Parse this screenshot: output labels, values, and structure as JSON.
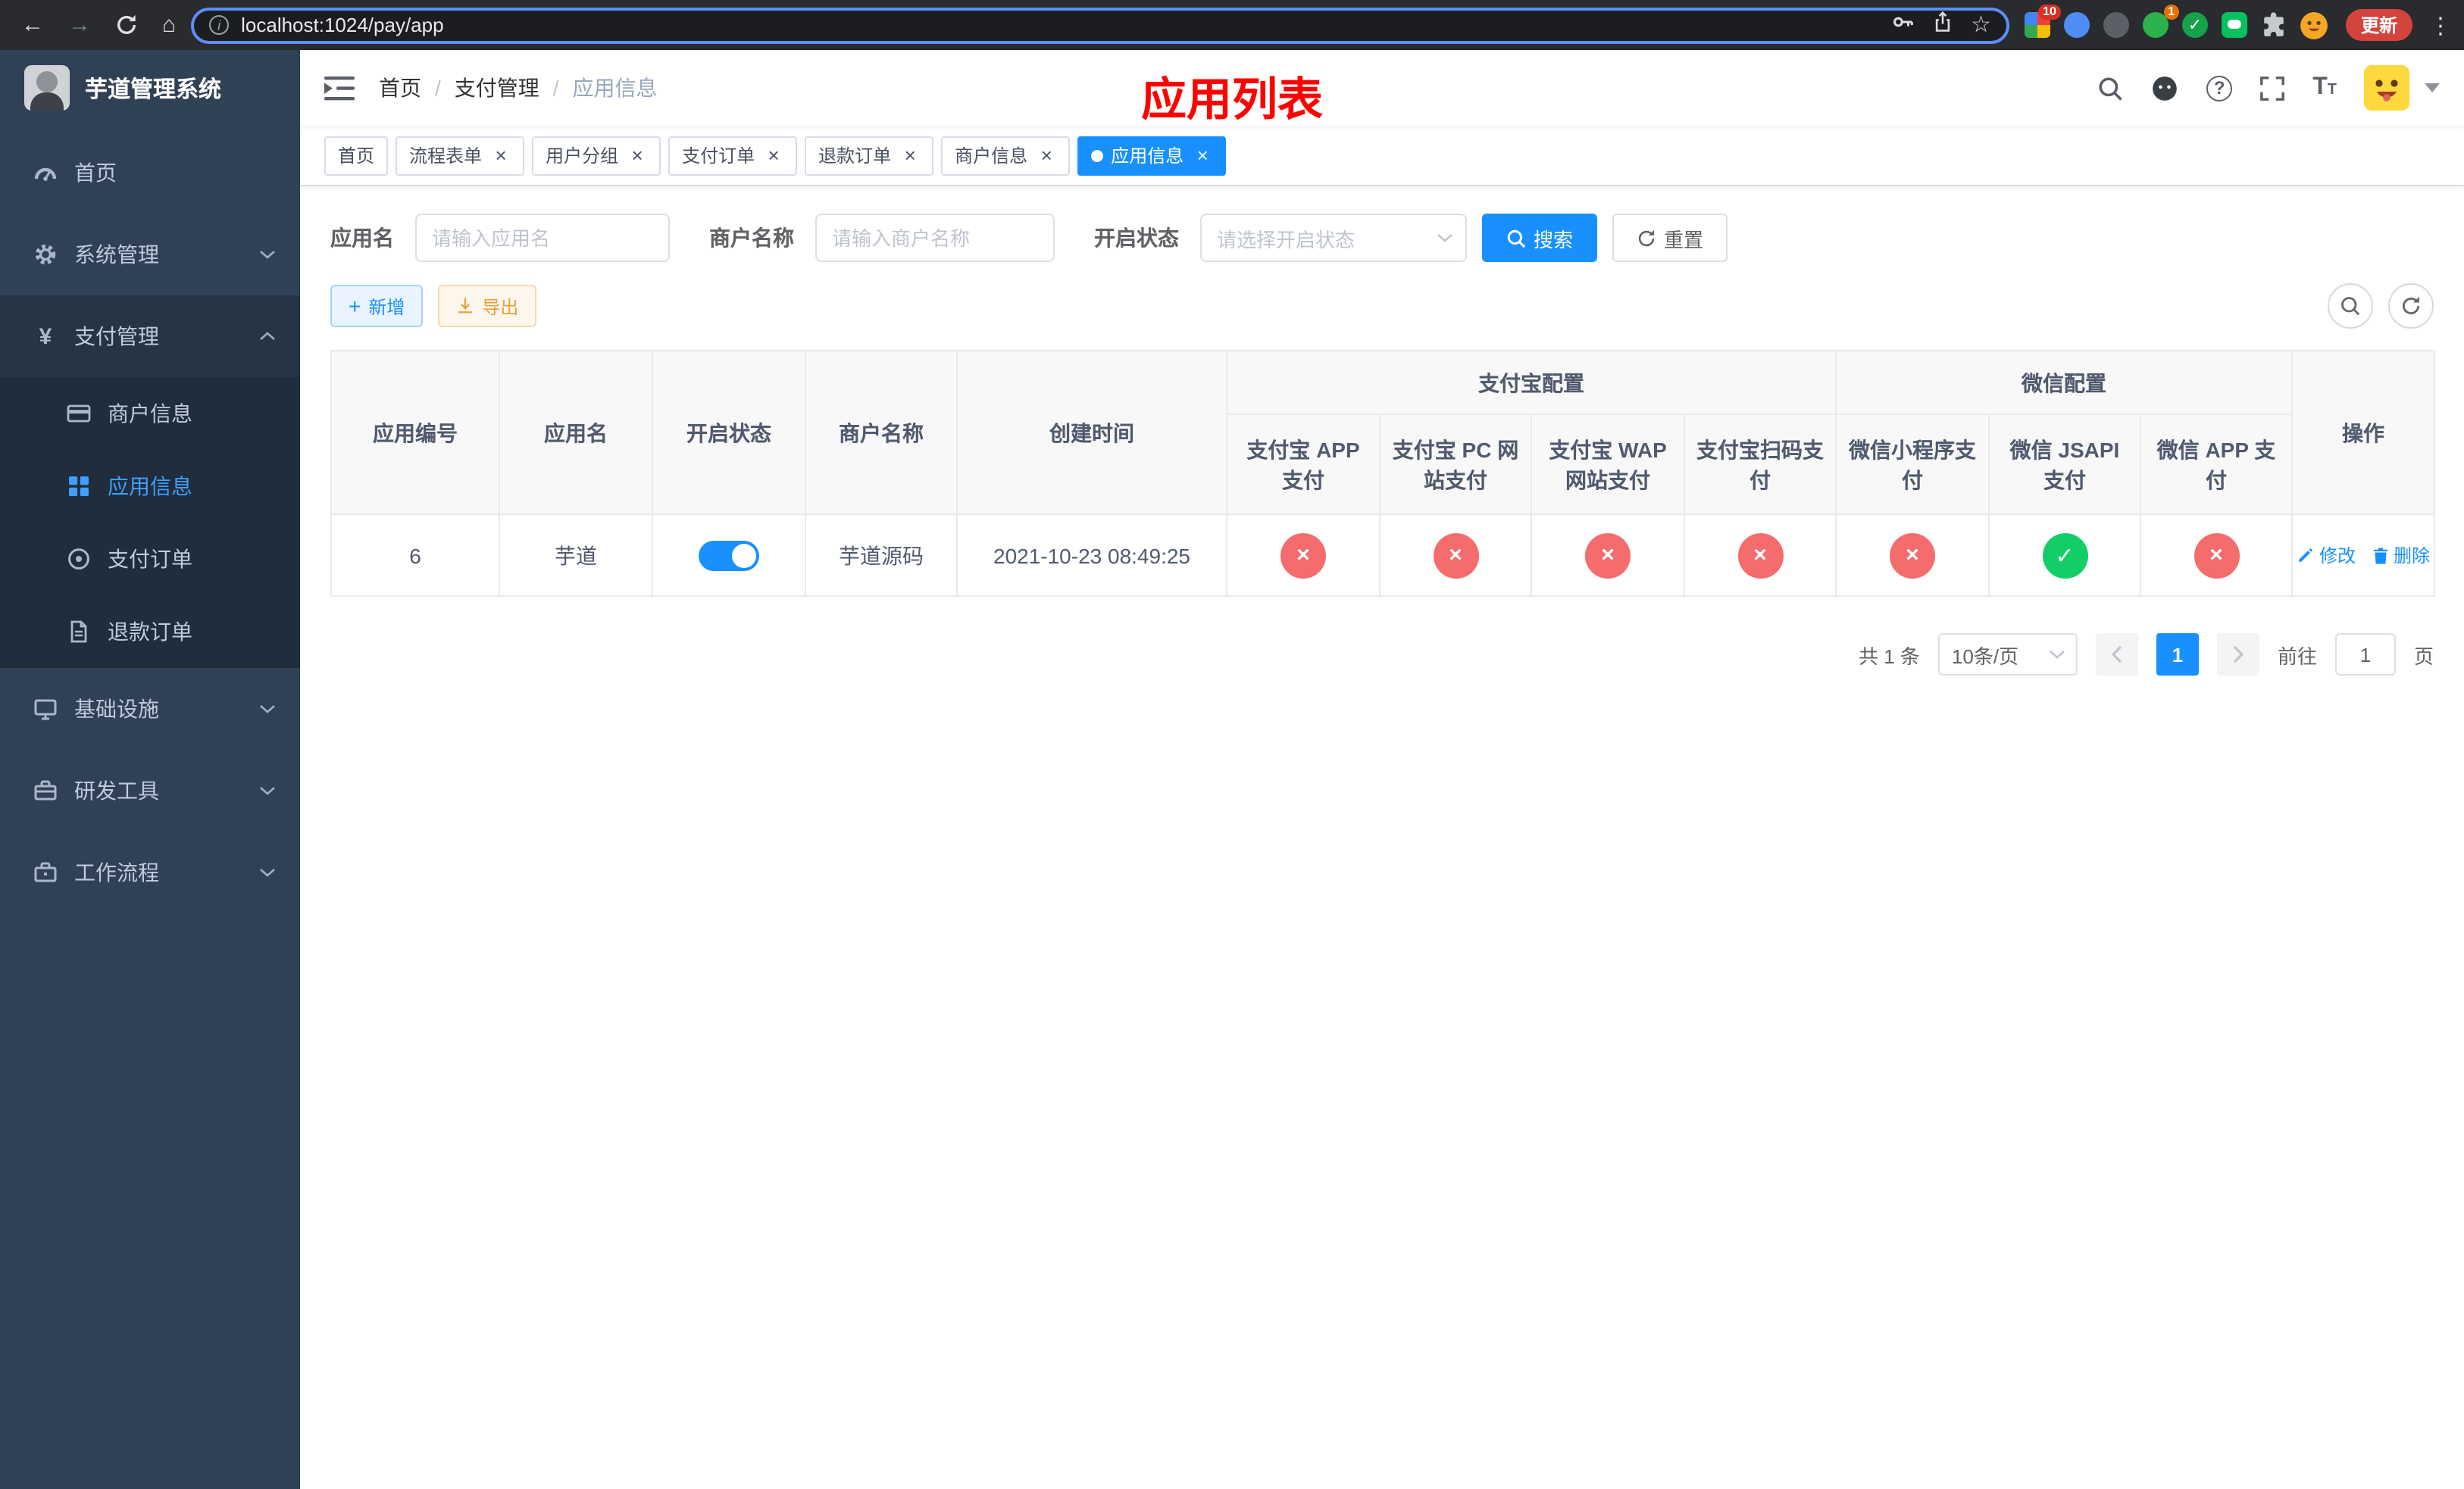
{
  "colors": {
    "primary": "#1890ff",
    "sidebar_active": "#409eff",
    "danger": "#f56c6c",
    "success": "#13ce66",
    "warning": "#e6a23c",
    "annotation": "#ff0000"
  },
  "icons": {
    "back": "←",
    "forward": "→",
    "home": "⌂",
    "info": "i",
    "star": "☆",
    "menu_dots": "⋮",
    "close": "×",
    "breadcrumb_sep": "/",
    "yen": "¥",
    "plus": "+",
    "help": "?",
    "font_big": "T",
    "font_small": "T",
    "check": "✓",
    "cross": "×"
  },
  "browser": {
    "url": "localhost:1024/pay/app",
    "update_label": "更新",
    "ext_badge_1": "10",
    "ext_badge_2": "1"
  },
  "sidebar": {
    "title": "芋道管理系统",
    "menu": [
      {
        "label": "首页"
      },
      {
        "label": "系统管理"
      },
      {
        "label": "支付管理"
      },
      {
        "label": "商户信息"
      },
      {
        "label": "应用信息"
      },
      {
        "label": "支付订单"
      },
      {
        "label": "退款订单"
      },
      {
        "label": "基础设施"
      },
      {
        "label": "研发工具"
      },
      {
        "label": "工作流程"
      }
    ]
  },
  "header": {
    "breadcrumb": [
      {
        "label": "首页"
      },
      {
        "label": "支付管理"
      },
      {
        "label": "应用信息"
      }
    ],
    "annotation": "应用列表"
  },
  "tabs": [
    {
      "label": "首页"
    },
    {
      "label": "流程表单"
    },
    {
      "label": "用户分组"
    },
    {
      "label": "支付订单"
    },
    {
      "label": "退款订单"
    },
    {
      "label": "商户信息"
    },
    {
      "label": "应用信息"
    }
  ],
  "filters": {
    "app_name_label": "应用名",
    "app_name_placeholder": "请输入应用名",
    "merchant_label": "商户名称",
    "merchant_placeholder": "请输入商户名称",
    "status_label": "开启状态",
    "status_placeholder": "请选择开启状态",
    "search_label": "搜索",
    "reset_label": "重置"
  },
  "toolbar": {
    "add_label": "新增",
    "export_label": "导出"
  },
  "table": {
    "groups": {
      "alipay": "支付宝配置",
      "wechat": "微信配置"
    },
    "columns": {
      "app_id": "应用编号",
      "app_name": "应用名",
      "enabled": "开启状态",
      "merchant_name": "商户名称",
      "create_time": "创建时间",
      "actions": "操作"
    },
    "alipay_columns": [
      "支付宝 APP 支付",
      "支付宝 PC 网站支付",
      "支付宝 WAP 网站支付",
      "支付宝扫码支付"
    ],
    "wechat_columns": [
      "微信小程序支付",
      "微信 JSAPI 支付",
      "微信 APP 支付"
    ],
    "rows": [
      {
        "app_id": "6",
        "app_name": "芋道",
        "enabled": true,
        "merchant_name": "芋道源码",
        "create_time": "2021-10-23 08:49:25",
        "statuses": [
          false,
          false,
          false,
          false,
          false,
          true,
          false
        ],
        "edit_label": "修改",
        "delete_label": "删除"
      }
    ]
  },
  "pagination": {
    "total_text": "共 1 条",
    "page_size_text": "10条/页",
    "current_page": "1",
    "goto_label": "前往",
    "goto_value": "1",
    "page_unit": "页"
  }
}
